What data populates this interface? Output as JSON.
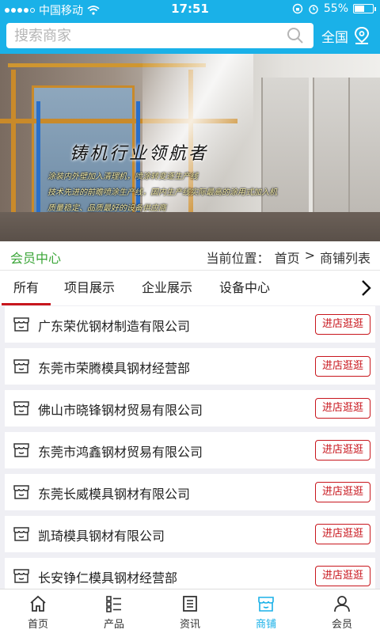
{
  "status_bar": {
    "carrier": "中国移动",
    "time": "17:51",
    "battery_percent": "55%",
    "battery_level": 0.55
  },
  "header": {
    "search_placeholder": "搜索商家",
    "region_label": "全国"
  },
  "banner": {
    "tagline": "铸机行业领航者",
    "slogans": [
      "涂装内外壁加入清理机，喷涂转变逐生产线",
      "技术先进的前瞻喷涂生产线，国内生产线实际最高的涂用式加入机",
      "质量稳定、品质最好的设备供应商"
    ]
  },
  "crumb_bar": {
    "member_center": "会员中心",
    "location_prefix": "当前位置：",
    "home": "首页",
    "separator": ">",
    "current": "商铺列表"
  },
  "tabs": [
    {
      "label": "所有",
      "active": true
    },
    {
      "label": "项目展示",
      "active": false
    },
    {
      "label": "企业展示",
      "active": false
    },
    {
      "label": "设备中心",
      "active": false
    }
  ],
  "shops": [
    {
      "name": "广东荣优钢材制造有限公司",
      "button": "进店逛逛"
    },
    {
      "name": "东莞市荣腾模具钢材经营部",
      "button": "进店逛逛"
    },
    {
      "name": "佛山市晓锋钢材贸易有限公司",
      "button": "进店逛逛"
    },
    {
      "name": "东莞市鸿鑫钢材贸易有限公司",
      "button": "进店逛逛"
    },
    {
      "name": "东莞长威模具钢材有限公司",
      "button": "进店逛逛"
    },
    {
      "name": "凯琦模具钢材有限公司",
      "button": "进店逛逛"
    },
    {
      "name": "长安铮仁模具钢材经营部",
      "button": "进店逛逛"
    }
  ],
  "tabbar": [
    {
      "label": "首页",
      "icon": "home-icon",
      "active": false
    },
    {
      "label": "产品",
      "icon": "product-list-icon",
      "active": false
    },
    {
      "label": "资讯",
      "icon": "news-icon",
      "active": false
    },
    {
      "label": "商铺",
      "icon": "shop-icon",
      "active": true
    },
    {
      "label": "会员",
      "icon": "user-icon",
      "active": false
    }
  ],
  "colors": {
    "brand_blue": "#1ab1e8",
    "accent_red": "#c8161d",
    "member_green": "#3aa537"
  }
}
